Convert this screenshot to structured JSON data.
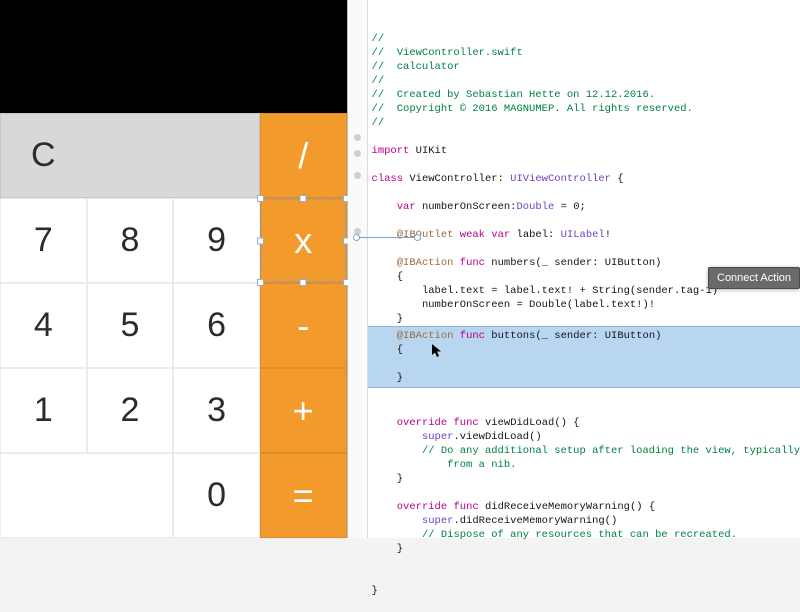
{
  "calc": {
    "rows": [
      [
        "C",
        "",
        "",
        "/"
      ],
      [
        "7",
        "8",
        "9",
        "x"
      ],
      [
        "4",
        "5",
        "6",
        "-"
      ],
      [
        "1",
        "2",
        "3",
        "+"
      ],
      [
        "",
        "0",
        "",
        "="
      ]
    ],
    "clear": "C",
    "divide": "/",
    "multiply": "x",
    "minus": "-",
    "plus": "+",
    "equals": "=",
    "n7": "7",
    "n8": "8",
    "n9": "9",
    "n4": "4",
    "n5": "5",
    "n6": "6",
    "n1": "1",
    "n2": "2",
    "n3": "3",
    "n0": "0"
  },
  "code": {
    "comments": {
      "slashes": "//",
      "file": "//  ViewController.swift",
      "project": "//  calculator",
      "blank2": "//",
      "created": "//  Created by Sebastian Hette on 12.12.2016.",
      "copyright": "//  Copyright © 2016 MAGNUMEP. All rights reserved.",
      "blank3": "//"
    },
    "import_kw": "import",
    "import_mod": "UIKit",
    "class_kw": "class",
    "class_name": "ViewController",
    "class_super": "UIViewController",
    "var_kw": "var",
    "var_name": "numberOnScreen",
    "double_type": "Double",
    "var_init": " = 0;",
    "iboutlet": "@IBOutlet",
    "weak_kw": "weak",
    "label_name": "label",
    "uilabel": "UILabel",
    "ibaction": "@IBAction",
    "func_kw": "func",
    "numbers_fn": "numbers",
    "sender_sig": "(_ sender: UIButton)",
    "label_assign": "label.text = label.text! + String(sender.tag-1)",
    "number_assign": "numberOnScreen = Double(label.text!)!",
    "buttons_fn": "buttons",
    "override_kw": "override",
    "viewdidload": "viewDidLoad",
    "super_vdl": "super",
    "vdl_call": ".viewDidLoad()",
    "vdl_comment": "// Do any additional setup after loading the view, typically\n            from a nib.",
    "mw_fn": "didReceiveMemoryWarning",
    "super_mw": "super",
    "mw_call": ".didReceiveMemoryWarning()",
    "mw_comment": "// Dispose of any resources that can be recreated."
  },
  "tooltip": "Connect Action"
}
